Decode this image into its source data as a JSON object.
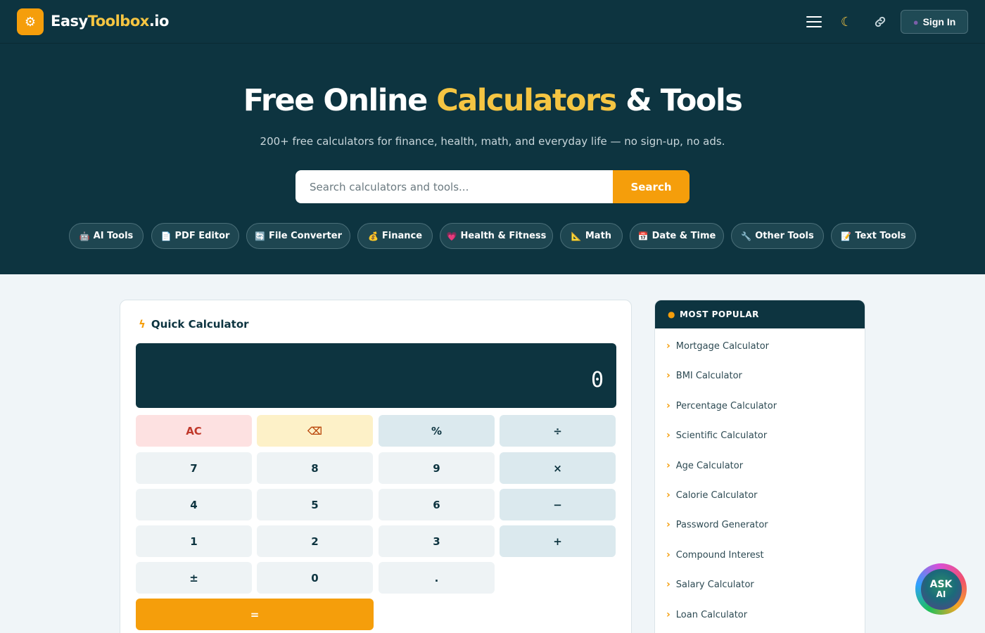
{
  "nav": {
    "logo_icon": "gear-icon",
    "logo_brand_start": "Easy",
    "logo_brand_accent": "Toolbox",
    "logo_brand_end": ".io",
    "menu_icon": "hamburger-icon",
    "theme_icon": "moon-icon",
    "link_icon": "link-icon",
    "signin_label": "Sign In"
  },
  "hero": {
    "title_start": "Free Online ",
    "title_accent": "Calculators",
    "title_end": " & Tools",
    "subtitle": "200+ free calculators for finance, health, math, and everyday life — no sign-up, no ads.",
    "search_placeholder": "Search calculators and tools...",
    "search_button": "Search",
    "categories": [
      {
        "icon": "🤖",
        "label": "AI Tools"
      },
      {
        "icon": "📄",
        "label": "PDF Editor"
      },
      {
        "icon": "🔄",
        "label": "File Converter"
      },
      {
        "icon": "💰",
        "label": "Finance"
      },
      {
        "icon": "💗",
        "label": "Health & Fitness"
      },
      {
        "icon": "📐",
        "label": "Math"
      },
      {
        "icon": "📅",
        "label": "Date & Time"
      },
      {
        "icon": "🔧",
        "label": "Other Tools"
      },
      {
        "icon": "📝",
        "label": "Text Tools"
      }
    ]
  },
  "calculator": {
    "icon": "bolt-icon",
    "title": "Quick Calculator",
    "display": "0",
    "keys": {
      "ac": "AC",
      "back": "⌫",
      "percent": "%",
      "divide": "÷",
      "seven": "7",
      "eight": "8",
      "nine": "9",
      "multiply": "×",
      "four": "4",
      "five": "5",
      "six": "6",
      "minus": "−",
      "one": "1",
      "two": "2",
      "three": "3",
      "plus": "+",
      "sign": "±",
      "zero": "0",
      "dot": ".",
      "equals": "="
    }
  },
  "popular": {
    "icon": "fire-icon",
    "title": "MOST POPULAR",
    "items": [
      "Mortgage Calculator",
      "BMI Calculator",
      "Percentage Calculator",
      "Scientific Calculator",
      "Age Calculator",
      "Calorie Calculator",
      "Password Generator",
      "Compound Interest",
      "Salary Calculator",
      "Loan Calculator"
    ]
  },
  "ask_ai": {
    "line1": "ASK",
    "line2": "AI"
  }
}
